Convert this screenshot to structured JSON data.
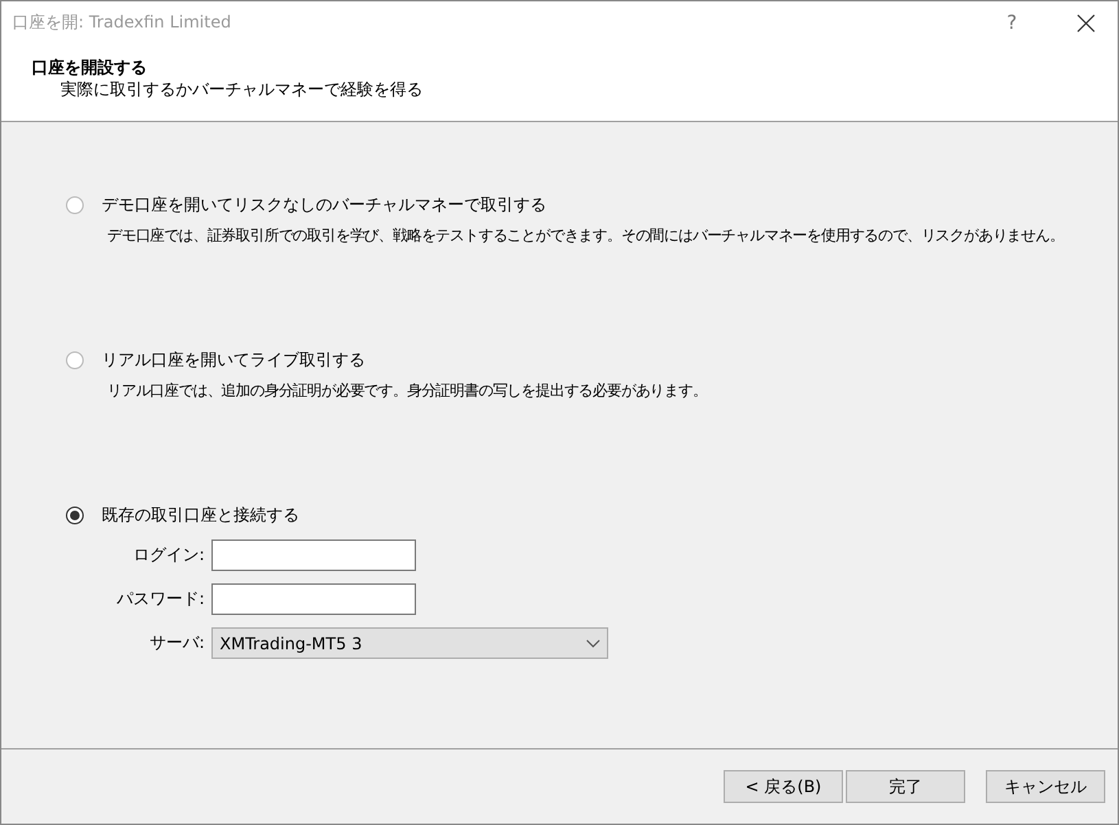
{
  "window": {
    "title": "口座を開: Tradexfin Limited",
    "help": "?"
  },
  "header": {
    "title": "口座を開設する",
    "subtitle": "実際に取引するかバーチャルマネーで経験を得る"
  },
  "options": [
    {
      "label": "デモ口座を開いてリスクなしのバーチャルマネーで取引する",
      "description": "デモ口座では、証券取引所での取引を学び、戦略をテストすることができます。その間にはバーチャルマネーを使用するので、リスクがありません。",
      "selected": false
    },
    {
      "label": "リアル口座を開いてライブ取引する",
      "description": "リアル口座では、追加の身分証明が必要です。身分証明書の写しを提出する必要があります。",
      "selected": false
    },
    {
      "label": "既存の取引口座と接続する",
      "selected": true,
      "fields": [
        {
          "kind": "text",
          "label": "ログイン:"
        },
        {
          "kind": "password",
          "label": "パスワード:"
        },
        {
          "kind": "select",
          "label": "サーバ:",
          "value": "XMTrading-MT5 3"
        }
      ]
    }
  ],
  "buttons": [
    {
      "label": "< 戻る(B)"
    },
    {
      "label": "完了"
    },
    {
      "label": "キャンセル"
    }
  ]
}
